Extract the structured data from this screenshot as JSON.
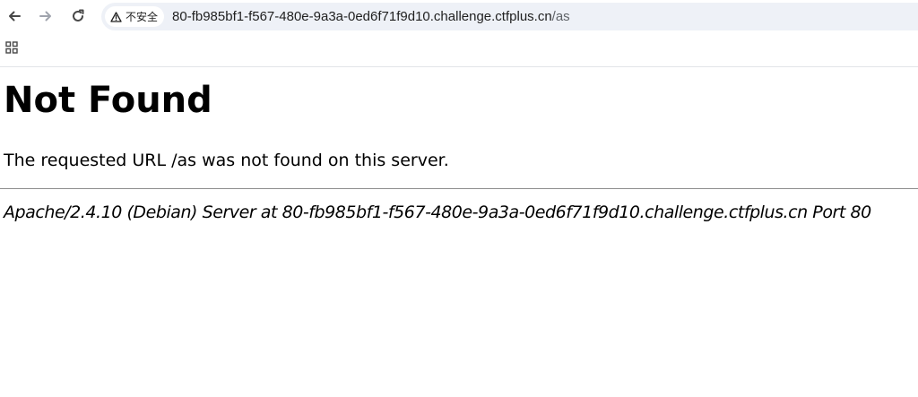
{
  "browser": {
    "security_label": "不安全",
    "url_host": "80-fb985bf1-f567-480e-9a3a-0ed6f71f9d10.challenge.ctfplus.cn",
    "url_path": "/as",
    "icons": [
      "back-arrow-icon",
      "forward-arrow-icon",
      "reload-icon",
      "warning-triangle-icon",
      "apps-grid-icon"
    ],
    "colors": {
      "omnibox_background": "#eef1f7",
      "disabled_icon": "#a0a4ad",
      "icon": "#474747"
    }
  },
  "page": {
    "title": "Not Found",
    "message": "The requested URL /as was not found on this server.",
    "server_signature": "Apache/2.4.10 (Debian) Server at 80-fb985bf1-f567-480e-9a3a-0ed6f71f9d10.challenge.ctfplus.cn Port 80"
  }
}
